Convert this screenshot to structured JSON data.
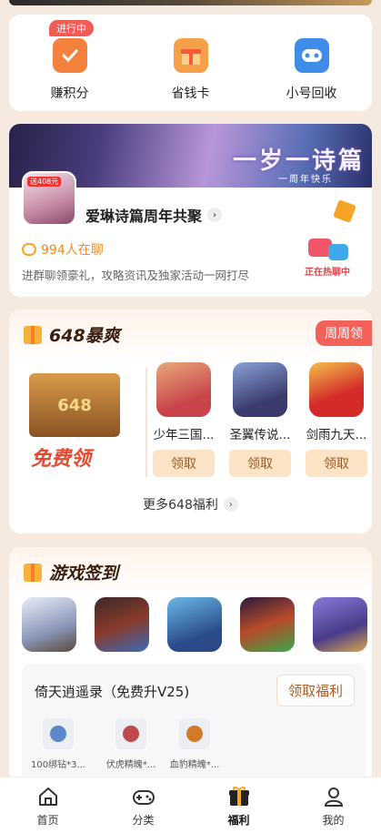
{
  "quick_menu": {
    "badge": "进行中",
    "items": [
      {
        "label": "赚积分",
        "icon": "task-check-icon"
      },
      {
        "label": "省钱卡",
        "icon": "gift-card-icon"
      },
      {
        "label": "小号回收",
        "icon": "gamepad-recycle-icon"
      }
    ]
  },
  "banner": {
    "headline": "一岁一诗篇",
    "subline": "一周年快乐",
    "game_tag": "送408元",
    "title": "爱琳诗篇周年共聚",
    "chat_count": "994人在聊",
    "description": "进群聊领豪礼，攻略资讯及独家活动一网打尽",
    "hot_chat_label": "正在热聊中"
  },
  "section_648": {
    "title": "648暴爽",
    "weekly_badge": "周周领",
    "chest_text": "648",
    "free_label": "免费领",
    "games": [
      {
        "name": "少年三国...",
        "button": "领取",
        "color": "#c8434a"
      },
      {
        "name": "圣翼传说...",
        "button": "领取",
        "color": "#4a5a9c"
      },
      {
        "name": "剑雨九天...",
        "button": "领取",
        "color": "#d42a2a"
      }
    ],
    "more": "更多648福利"
  },
  "signin": {
    "title": "游戏签到",
    "game_icons": [
      "#b8c4d8",
      "#6a3a2a",
      "#4a8ac0",
      "#b84a2a",
      "#7a5ab8"
    ],
    "selected_game": "倚天逍遥录（免费升V25)",
    "claim_button": "领取福利",
    "rewards": [
      {
        "label": "100绑钻*3...",
        "color": "#5a88c8"
      },
      {
        "label": "伏虎精魄*...",
        "color": "#c04a4a"
      },
      {
        "label": "血豹精魄*...",
        "color": "#d07a2a"
      }
    ]
  },
  "bottom_nav": {
    "items": [
      {
        "label": "首页",
        "icon": "home-icon"
      },
      {
        "label": "分类",
        "icon": "gamepad-icon"
      },
      {
        "label": "福利",
        "icon": "gift-icon",
        "active": true
      },
      {
        "label": "我的",
        "icon": "user-icon"
      }
    ]
  },
  "colors": {
    "accent": "#f08a1c",
    "badge_red": "#f2625a",
    "claim_bg": "#fde4c6"
  }
}
